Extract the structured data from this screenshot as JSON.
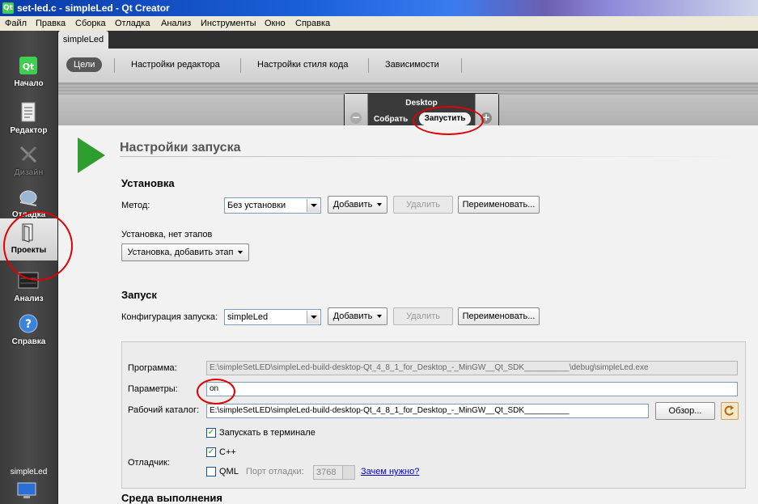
{
  "window": {
    "title": "set-led.c - simpleLed - Qt Creator"
  },
  "menu": [
    "Файл",
    "Правка",
    "Сборка",
    "Отладка",
    "Анализ",
    "Инструменты",
    "Окно",
    "Справка"
  ],
  "sidebar": {
    "items": [
      {
        "label": "Начало",
        "icon": "qt-logo-icon"
      },
      {
        "label": "Редактор",
        "icon": "document-icon"
      },
      {
        "label": "Дизайн",
        "icon": "design-tools-icon",
        "disabled": true
      },
      {
        "label": "Отладка",
        "icon": "debug-bug-icon"
      },
      {
        "label": "Проекты",
        "icon": "projects-folder-icon",
        "active": true
      },
      {
        "label": "Анализ",
        "icon": "analyze-chart-icon"
      },
      {
        "label": "Справка",
        "icon": "help-icon"
      }
    ],
    "bottom_label": "simpleLed"
  },
  "project_tab": "simpleLed",
  "subtabs": [
    "Цели",
    "Настройки редактора",
    "Настройки стиля кода",
    "Зависимости"
  ],
  "target_selector": {
    "kit": "Desktop",
    "build": "Собрать",
    "run": "Запустить"
  },
  "page_title": "Настройки запуска",
  "install": {
    "heading": "Установка",
    "method_label": "Метод:",
    "method_value": "Без установки",
    "add": "Добавить",
    "remove": "Удалить",
    "rename": "Переименовать...",
    "steps_label": "Установка, нет этапов",
    "add_step": "Установка, добавить этап"
  },
  "run": {
    "heading": "Запуск",
    "config_label": "Конфигурация запуска:",
    "config_value": "simpleLed",
    "add": "Добавить",
    "remove": "Удалить",
    "rename": "Переименовать...",
    "program_label": "Программа:",
    "program_value": "E:\\simpleSetLED\\simpleLed-build-desktop-Qt_4_8_1_for_Desktop_-_MinGW__Qt_SDK__________\\debug\\simpleLed.exe",
    "args_label": "Параметры:",
    "args_value": "on",
    "workdir_label": "Рабочий каталог:",
    "workdir_value": "E:\\simpleSetLED\\simpleLed-build-desktop-Qt_4_8_1_for_Desktop_-_MinGW__Qt_SDK__________",
    "browse": "Обзор...",
    "run_in_terminal": "Запускать в терминале",
    "debugger_label": "Отладчик:",
    "cpp": "C++",
    "qml": "QML",
    "debug_port_label": "Порт отладки:",
    "debug_port_value": "3768",
    "why_link": "Зачем нужно?"
  },
  "env_heading": "Среда выполнения",
  "colors": {
    "annotation": "#e00000",
    "run_green": "#2e9e2e",
    "sidebar": "#3a3a3a"
  }
}
